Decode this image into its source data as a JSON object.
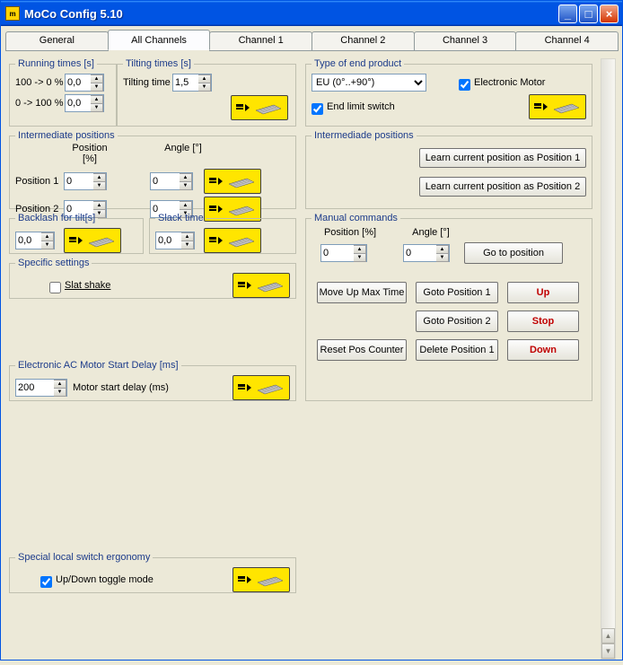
{
  "window": {
    "title": "MoCo Config 5.10"
  },
  "tabs": {
    "general": "General",
    "all_channels": "All Channels",
    "ch1": "Channel 1",
    "ch2": "Channel 2",
    "ch3": "Channel 3",
    "ch4": "Channel 4"
  },
  "running": {
    "legend": "Running times [s]",
    "l100to0": "100 -> 0 %",
    "v100to0": "0,0",
    "l0to100": "0 -> 100 %",
    "v0to100": "0,0"
  },
  "tilting": {
    "legend": "Tilting times [s]",
    "label": "Tilting time",
    "value": "1,5"
  },
  "intpos": {
    "legend": "Intermediate positions",
    "poshdr": "Position [%]",
    "anghdr": "Angle [°]",
    "pos1lbl": "Position 1",
    "pos1pos": "0",
    "pos1ang": "0",
    "pos2lbl": "Position 2",
    "pos2pos": "0",
    "pos2ang": "0"
  },
  "backlash": {
    "legend": "Backlash for tilt[s]",
    "value": "0,0"
  },
  "slack": {
    "legend": "Slack time",
    "value": "0,0"
  },
  "specific": {
    "legend": "Specific settings",
    "slat": "Slat shake"
  },
  "acdelay": {
    "legend": "Electronic AC Motor Start Delay [ms]",
    "label": "Motor start delay (ms)",
    "value": "200"
  },
  "special": {
    "legend": "Special local switch ergonomy",
    "label": "Up/Down toggle mode"
  },
  "endproduct": {
    "legend": "Type of end product",
    "region": "EU (0°..+90°)",
    "motor": "Electronic Motor",
    "endlimit": "End limit switch"
  },
  "intpos2": {
    "legend": "Intermediade positions",
    "learn1": "Learn current position as Position 1",
    "learn2": "Learn current position as Position 2"
  },
  "manual": {
    "legend": "Manual commands",
    "poshdr": "Position [%]",
    "anghdr": "Angle [°]",
    "pos": "0",
    "ang": "0",
    "go": "Go to position",
    "moveup": "Move Up Max Time",
    "goto1": "Goto Position 1",
    "up": "Up",
    "goto2": "Goto Position 2",
    "stop": "Stop",
    "reset": "Reset Pos Counter",
    "del1": "Delete Position 1",
    "down": "Down"
  }
}
